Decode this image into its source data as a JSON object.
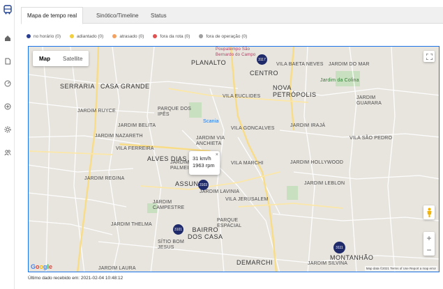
{
  "sidebar": {
    "items": [
      {
        "icon": "bus-icon"
      },
      {
        "icon": "home-icon"
      },
      {
        "icon": "document-icon"
      },
      {
        "icon": "gauge-icon"
      },
      {
        "icon": "add-circle-icon"
      },
      {
        "icon": "gear-icon"
      },
      {
        "icon": "users-icon"
      }
    ]
  },
  "tabs": [
    {
      "label": "Mapa de tempo real"
    },
    {
      "label": "Sinótico/Timeline"
    },
    {
      "label": "Status"
    }
  ],
  "legend": [
    {
      "label": "no horário (0)",
      "color": "#2a3f8f"
    },
    {
      "label": "adiantado (0)",
      "color": "#f2cf3c"
    },
    {
      "label": "atrasado (0)",
      "color": "#f4a261"
    },
    {
      "label": "fora da rota (0)",
      "color": "#e05252"
    },
    {
      "label": "fora de operação (0)",
      "color": "#9e9e9e"
    }
  ],
  "map": {
    "type_buttons": {
      "map": "Map",
      "satellite": "Satellite"
    },
    "labels": {
      "serraria": "SERRARIA",
      "casa_grande": "CASA GRANDE",
      "planalto": "PLANALTO",
      "centro": "CENTRO",
      "nova_petropolis": "NOVA\nPETRÓPOLIS",
      "alves_dias": "ALVES DIAS",
      "assunc": "ASSUNÇ",
      "bairro_dos_casa": "BAIRRO\nDOS CASA",
      "demarchi": "DEMARCHI",
      "montanhao": "MONTANHÃO",
      "jardim_ruyce": "JARDIM RUYCE",
      "jardim_belita": "JARDIM BELITA",
      "vila_ferreira": "VILA FERREIRA",
      "jardim_regina": "JARDIM REGINA",
      "jardim_campestre": "JARDIM\nCAMPESTRE",
      "jardim_thelma": "JARDIM THELMA",
      "vila_jerusalem": "VILA JERUSALEM",
      "jardim_lavinia": "JARDIM LAVINIA",
      "vila_goncalves": "VILA GONCALVES",
      "vila_marchi": "VILA MARCHI",
      "jardim_hollywood": "JARDIM HOLLYWOOD",
      "jardim_iraja": "JARDIM IRAJÁ",
      "vila_sao_pedro": "VILA SÃO PEDRO",
      "jardim_leblon": "JARDIM LEBLON",
      "jardim_silvina": "JARDIM SILVINA",
      "jardim_da_colina": "Jardim da Colina",
      "scania": "Scania",
      "poupatempo": "Poupatempo São\nBernardo do Campo",
      "vila_baeta_neves": "VILA BAETA NEVES",
      "jardim_do_mar": "JARDIM DO MAR",
      "jardim_guarara": "JARDIM\nGUARARA",
      "jardim_via_anchieta": "JARDIM VIA\nANCHIETA",
      "jardim_palmeiras": "JARDIM\nPALMEIRAS",
      "parque_dos_ipes": "PARQUE DOS\nIPÊS",
      "jardim_nazareth": "JARDIM NAZARETH",
      "vila_euclides": "VILA EUCLIDES",
      "parque_espacial": "PARQUE\nESPACIAL",
      "sitio_bom_jesus": "SÍTIO BOM\nJESUS",
      "jardim_laura": "JARDIM LAURA"
    },
    "markers": [
      {
        "id": "3117"
      },
      {
        "id": "3103"
      },
      {
        "id": "3101"
      },
      {
        "id": "3111"
      }
    ],
    "infowindow": {
      "speed": "31 km/h",
      "rpm": "1963 rpm",
      "close": "×"
    },
    "google": "Google",
    "attribution": "Map data ©2021   Terms of Use   Report a map error"
  },
  "footer": "Último dado recebido em: 2021-02-04 10:48:12"
}
